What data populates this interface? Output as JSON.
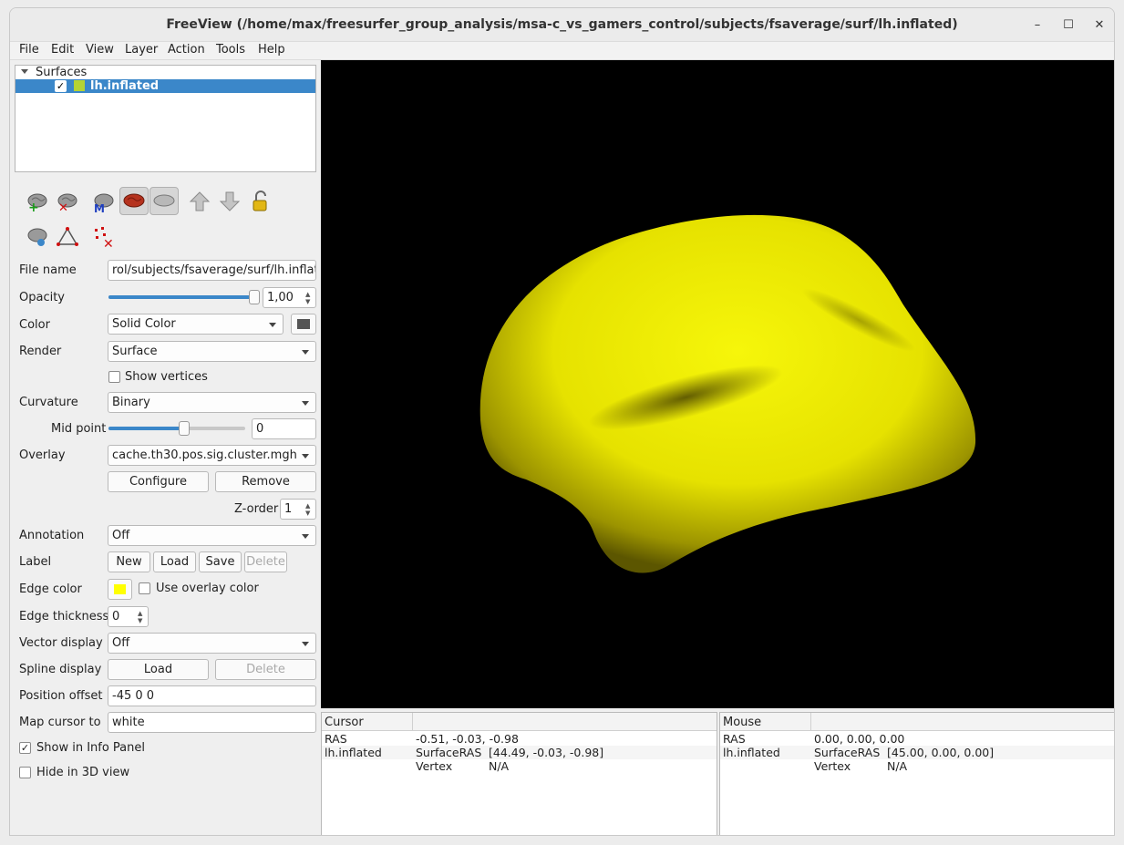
{
  "window": {
    "title": "FreeView (/home/max/freesurfer_group_analysis/msa-c_vs_gamers_control/subjects/fsaverage/surf/lh.inflated)",
    "minimize": "–",
    "maximize": "☐",
    "close": "✕"
  },
  "menu": [
    "File",
    "Edit",
    "View",
    "Layer",
    "Action",
    "Tools",
    "Help"
  ],
  "layers": {
    "group": "Surfaces",
    "item": "lh.inflated",
    "item_checked": "✓",
    "item_color": "#b5d334"
  },
  "props": {
    "file_name_label": "File name",
    "file_name": "rol/subjects/fsaverage/surf/lh.inflated",
    "opacity_label": "Opacity",
    "opacity": "1,00",
    "opacity_level": 1.0,
    "color_label": "Color",
    "color_mode": "Solid Color",
    "render_label": "Render",
    "render": "Surface",
    "show_vertices": "Show vertices",
    "curvature_label": "Curvature",
    "curvature": "Binary",
    "midpoint_label": "Mid point",
    "midpoint": "0",
    "midpoint_level": 0.55,
    "overlay_label": "Overlay",
    "overlay": "cache.th30.pos.sig.cluster.mgh",
    "configure": "Configure",
    "remove": "Remove",
    "zorder_label": "Z-order",
    "zorder": "1",
    "annotation_label": "Annotation",
    "annotation": "Off",
    "label_label": "Label",
    "label_new": "New",
    "label_load": "Load",
    "label_save": "Save",
    "label_delete": "Delete",
    "edge_color_label": "Edge color",
    "edge_color": "#ffff00",
    "use_overlay_color": "Use overlay color",
    "edge_thickness_label": "Edge thickness",
    "edge_thickness": "0",
    "vector_display_label": "Vector display",
    "vector_display": "Off",
    "spline_display_label": "Spline display",
    "spline_load": "Load",
    "spline_delete": "Delete",
    "position_offset_label": "Position offset",
    "position_offset": "-45 0 0",
    "map_cursor_label": "Map cursor to",
    "map_cursor": "white",
    "show_info_panel": "Show in Info Panel",
    "show_info_checked": "✓",
    "hide_3d": "Hide in 3D view"
  },
  "cursor_panel": {
    "header": "Cursor",
    "rows": [
      {
        "a": "RAS",
        "b": "-0.51, -0.03, -0.98",
        "c": ""
      },
      {
        "a": "lh.inflated",
        "b": "SurfaceRAS",
        "c": "[44.49, -0.03, -0.98]"
      },
      {
        "a": "",
        "b": "Vertex",
        "c": "N/A"
      }
    ]
  },
  "mouse_panel": {
    "header": "Mouse",
    "rows": [
      {
        "a": "RAS",
        "b": "0.00, 0.00, 0.00",
        "c": ""
      },
      {
        "a": "lh.inflated",
        "b": "SurfaceRAS",
        "c": "[45.00, 0.00, 0.00]"
      },
      {
        "a": "",
        "b": "Vertex",
        "c": "N/A"
      }
    ]
  }
}
